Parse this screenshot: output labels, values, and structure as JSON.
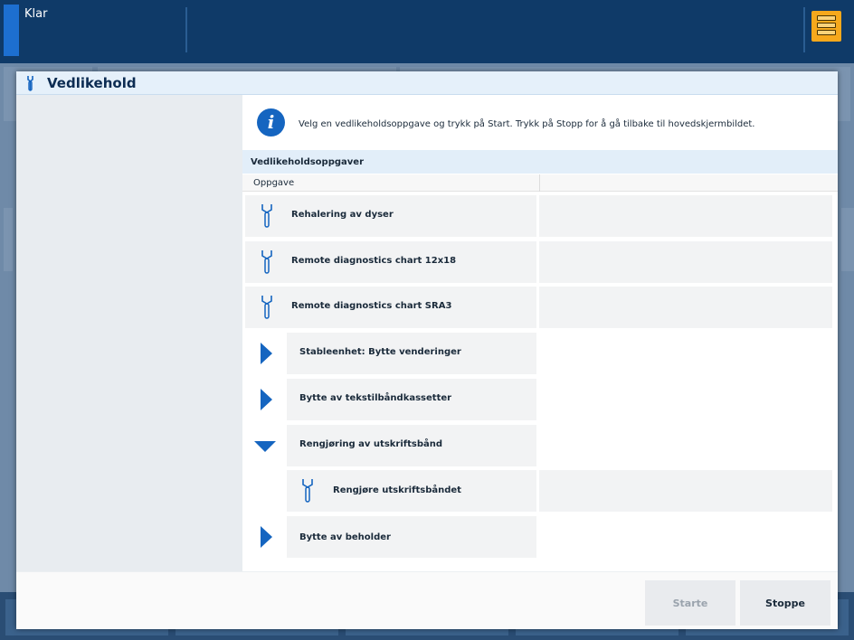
{
  "topbar": {
    "status": "Klar",
    "queue_icon": "job-queue-icon"
  },
  "dialog": {
    "title": "Vedlikehold",
    "title_icon": "wrench-icon",
    "info_icon": "info-icon",
    "info_text": "Velg en vedlikeholdsoppgave og trykk på Start. Trykk på Stopp for å gå tilbake til hovedskjermbildet.",
    "section_title": "Vedlikeholdsoppgaver",
    "column_task": "Oppgave",
    "tasks": [
      {
        "label": "Rehalering av dyser",
        "kind": "task"
      },
      {
        "label": "Remote diagnostics chart 12x18",
        "kind": "task"
      },
      {
        "label": "Remote diagnostics chart SRA3",
        "kind": "task"
      },
      {
        "label": "Stableenhet: Bytte venderinger",
        "kind": "group-collapsed"
      },
      {
        "label": "Bytte av tekstilbåndkassetter",
        "kind": "group-collapsed"
      },
      {
        "label": "Rengjøring av utskriftsbånd",
        "kind": "group-expanded"
      },
      {
        "label": "Rengjøre utskriftsbåndet",
        "kind": "subtask"
      },
      {
        "label": "Bytte av beholder",
        "kind": "group-collapsed"
      }
    ],
    "buttons": {
      "start": "Starte",
      "stop": "Stoppe"
    }
  },
  "colors": {
    "accent": "#1565c0",
    "topbar": "#0f3a68",
    "queue_button": "#f6a81c"
  }
}
